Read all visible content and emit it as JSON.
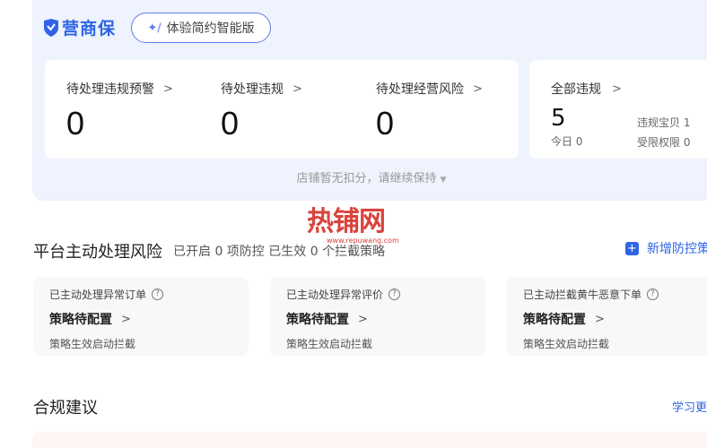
{
  "header": {
    "logo_text": "营商保",
    "version_button_label": "体验简约智能版"
  },
  "stats": [
    {
      "title": "待处理违规预警",
      "value": "0"
    },
    {
      "title": "待处理违规",
      "value": "0"
    },
    {
      "title": "待处理经营风险",
      "value": "0"
    }
  ],
  "violations": {
    "title": "全部违规",
    "total": "5",
    "today": "今日 0",
    "items": [
      "违规宝贝 1",
      "受限权限 0"
    ]
  },
  "shop_note": "店铺暂无扣分，请继续保持",
  "watermark": {
    "text": "热铺网",
    "url": "www.repuwang.com"
  },
  "platform_section": {
    "title": "平台主动处理风险",
    "subtitle": "已开启 0 项防控 已生效 0 个拦截策略",
    "add_button_label": "新增防控策"
  },
  "risk_cards": [
    {
      "title": "已主动处理异常订单",
      "status": "策略待配置",
      "desc": "策略生效启动拦截"
    },
    {
      "title": "已主动处理异常评价",
      "status": "策略待配置",
      "desc": "策略生效启动拦截"
    },
    {
      "title": "已主动拦截黄牛恶意下单",
      "status": "策略待配置",
      "desc": "策略生效启动拦截"
    }
  ],
  "compliance": {
    "title": "合规建议",
    "learn_more": "学习更"
  },
  "icons": {
    "chevron": "chevron-right-icon",
    "help": "question-circle-icon",
    "add": "plus-square-icon"
  },
  "colors": {
    "brand": "#2f64e6",
    "panel_bg": "#eef3fd",
    "watermark": "#d9443d"
  }
}
